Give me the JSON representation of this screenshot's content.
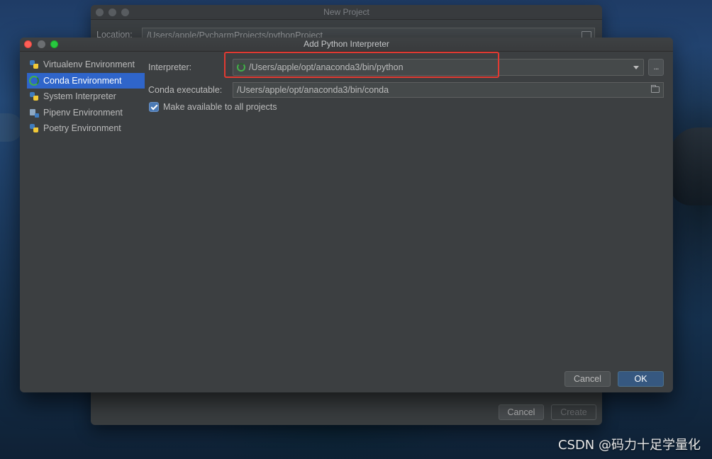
{
  "background_window": {
    "title": "New Project",
    "location_label": "Location:",
    "location_value": "/Users/apple/PycharmProjects/pythonProject",
    "cancel_label": "Cancel",
    "create_label": "Create"
  },
  "dialog": {
    "title": "Add Python Interpreter",
    "sidebar": {
      "items": [
        {
          "label": "Virtualenv Environment",
          "icon": "python-icon",
          "selected": false
        },
        {
          "label": "Conda Environment",
          "icon": "conda-icon",
          "selected": true
        },
        {
          "label": "System Interpreter",
          "icon": "python-icon",
          "selected": false
        },
        {
          "label": "Pipenv Environment",
          "icon": "pipenv-icon",
          "selected": false
        },
        {
          "label": "Poetry Environment",
          "icon": "python-icon",
          "selected": false
        }
      ]
    },
    "form": {
      "interpreter_label": "Interpreter:",
      "interpreter_value": "/Users/apple/opt/anaconda3/bin/python",
      "browse_label": "...",
      "conda_executable_label": "Conda executable:",
      "conda_executable_value": "/Users/apple/opt/anaconda3/bin/conda",
      "make_available_label": "Make available to all projects",
      "make_available_checked": true
    },
    "buttons": {
      "cancel_label": "Cancel",
      "ok_label": "OK"
    }
  },
  "colors": {
    "accent_selected": "#2f65ca",
    "highlight_box": "#e23a32",
    "ok_button": "#365880"
  },
  "watermark": "CSDN @码力十足学量化"
}
